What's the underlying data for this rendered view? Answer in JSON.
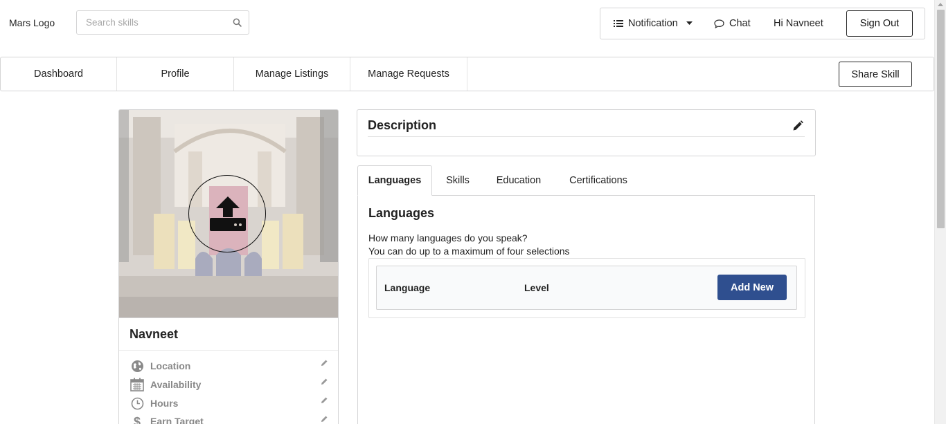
{
  "header": {
    "logo": "Mars Logo",
    "search_placeholder": "Search skills",
    "notification": "Notification",
    "chat": "Chat",
    "greeting": "Hi Navneet",
    "sign_out": "Sign Out"
  },
  "nav": {
    "items": [
      {
        "label": "Dashboard"
      },
      {
        "label": "Profile"
      },
      {
        "label": "Manage Listings"
      },
      {
        "label": "Manage Requests"
      }
    ],
    "share_skill": "Share Skill"
  },
  "profile": {
    "name": "Navneet",
    "details": [
      {
        "label": "Location",
        "icon": "globe-icon"
      },
      {
        "label": "Availability",
        "icon": "calendar-icon"
      },
      {
        "label": "Hours",
        "icon": "clock-icon"
      },
      {
        "label": "Earn Target",
        "icon": "dollar-icon"
      }
    ]
  },
  "description": {
    "title": "Description"
  },
  "tabs": [
    {
      "label": "Languages",
      "active": true
    },
    {
      "label": "Skills",
      "active": false
    },
    {
      "label": "Education",
      "active": false
    },
    {
      "label": "Certifications",
      "active": false
    }
  ],
  "languages": {
    "title": "Languages",
    "line1": "How many languages do you speak?",
    "line2": "You can do up to a maximum of four selections",
    "col_language": "Language",
    "col_level": "Level",
    "add_new": "Add New"
  },
  "colors": {
    "primary_button": "#2f4f8f",
    "border": "#d4d4d5"
  }
}
